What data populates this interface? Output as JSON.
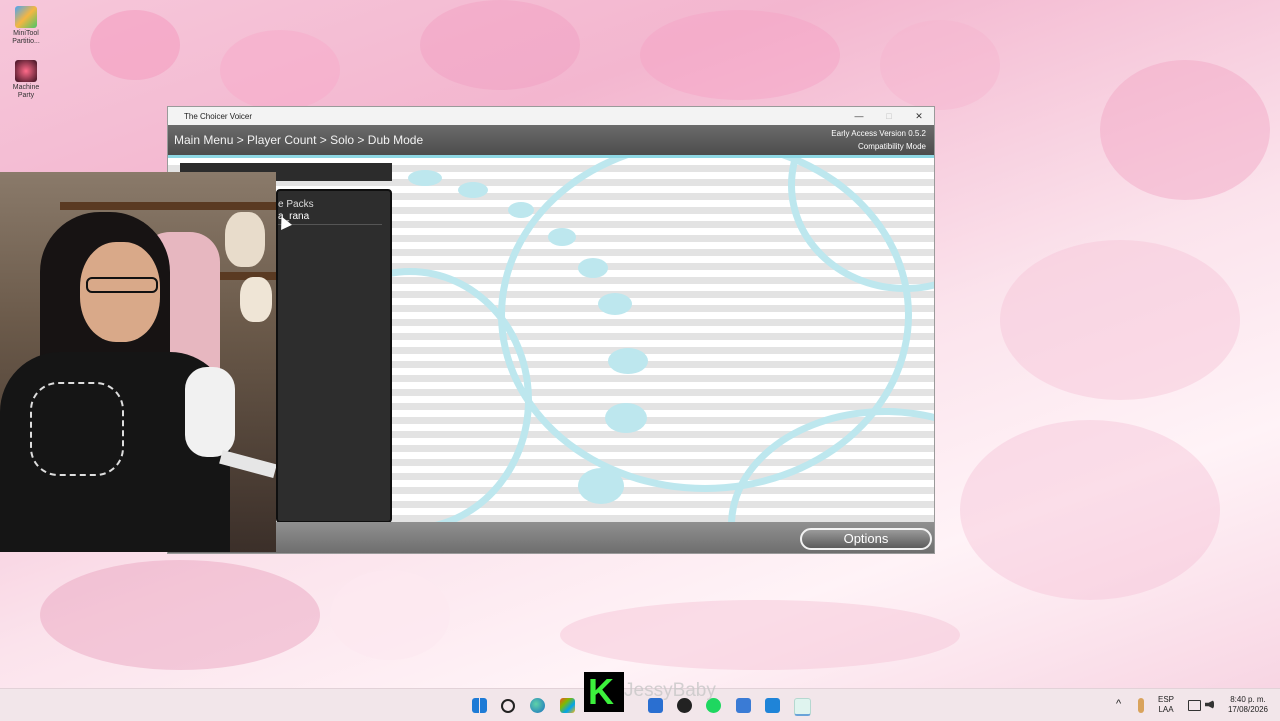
{
  "desktop": {
    "icons": [
      {
        "label": "MiniTool Partitio..."
      },
      {
        "label": "Machine Party"
      }
    ]
  },
  "window": {
    "title": "The Choicer Voicer",
    "controls": {
      "minimize": "—",
      "maximize": "□",
      "close": "✕"
    }
  },
  "app": {
    "breadcrumb": "Main Menu > Player Count > Solo > Dub Mode",
    "version_line1": "Early Access Version 0.5.2",
    "version_line2": "Compatibility Mode",
    "pack_panel": {
      "title": "e Packs",
      "items": [
        "a_rana"
      ]
    },
    "options_label": "Options"
  },
  "overlay": {
    "logo_letter": "K",
    "streamer_name": "JessyBaby"
  },
  "taskbar": {
    "lang_top": "ESP",
    "lang_bottom": "LAA",
    "time": "8:40 p. m.",
    "date": "17/08/2026",
    "tray_chevron": "^"
  },
  "colors": {
    "accent_teal": "#8fd8e4",
    "window_header": "#5a5a5a",
    "overlay_green": "#3cf03c"
  }
}
